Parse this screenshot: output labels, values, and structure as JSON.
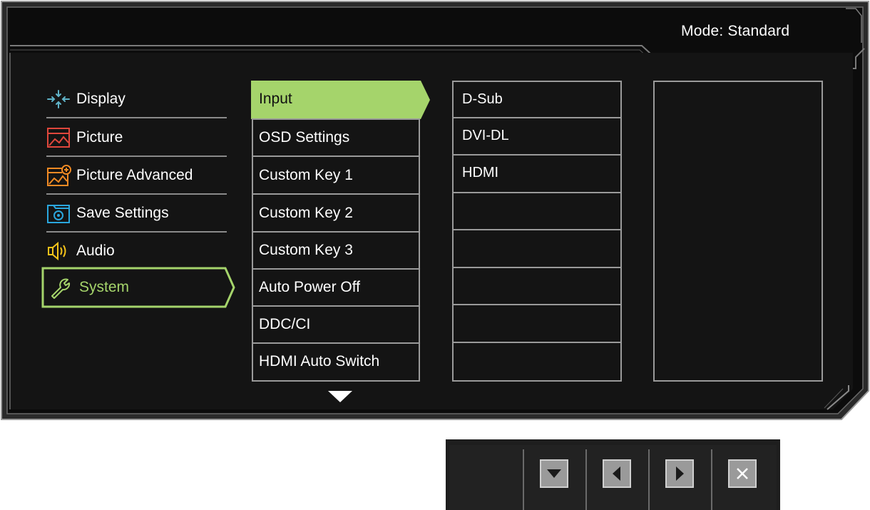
{
  "header": {
    "mode_label": "Mode: Standard"
  },
  "categories": [
    {
      "label": "Display",
      "icon": "display-crosshair-icon",
      "color": "#5fb3c8"
    },
    {
      "label": "Picture",
      "icon": "picture-icon",
      "color": "#e0473c"
    },
    {
      "label": "Picture Advanced",
      "icon": "picture-advanced-icon",
      "color": "#f08a24"
    },
    {
      "label": "Save Settings",
      "icon": "save-settings-icon",
      "color": "#2aa7de"
    },
    {
      "label": "Audio",
      "icon": "speaker-icon",
      "color": "#f5c31a"
    },
    {
      "label": "System",
      "icon": "wrench-icon",
      "color": "#a5d46b",
      "selected": true
    }
  ],
  "submenu": [
    {
      "label": "Input",
      "active": true
    },
    {
      "label": "OSD Settings"
    },
    {
      "label": "Custom Key 1"
    },
    {
      "label": "Custom Key 2"
    },
    {
      "label": "Custom Key 3"
    },
    {
      "label": "Auto Power Off"
    },
    {
      "label": "DDC/CI"
    },
    {
      "label": "HDMI Auto Switch"
    }
  ],
  "options": [
    "D-Sub",
    "DVI-DL",
    "HDMI"
  ],
  "controls": {
    "buttons": [
      "down-icon",
      "left-icon",
      "right-icon",
      "close-icon"
    ]
  },
  "colors": {
    "accent": "#a5d46b",
    "frame_bg": "#141414",
    "border": "#9a9a9a"
  }
}
